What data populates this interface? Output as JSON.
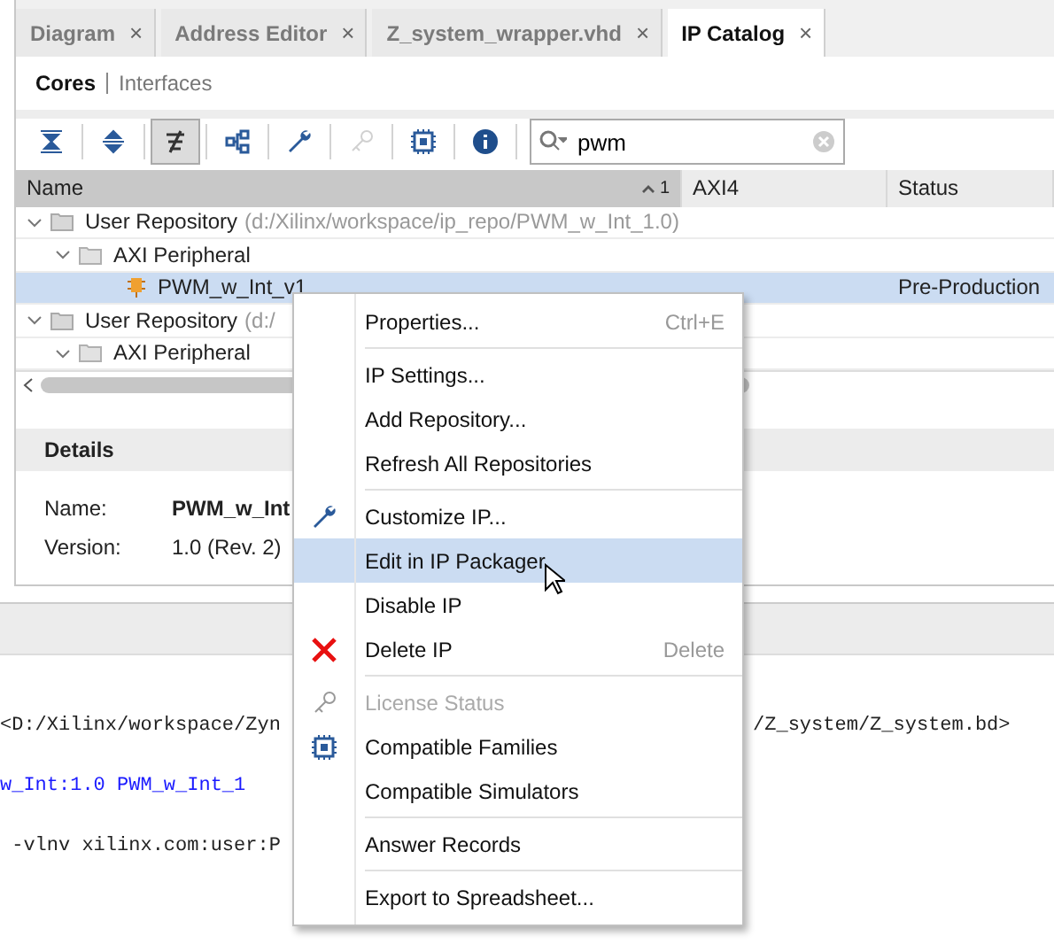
{
  "tabs": [
    {
      "label": "Diagram",
      "close": "×",
      "selected": false
    },
    {
      "label": "Address Editor",
      "close": "×",
      "selected": false
    },
    {
      "label": "Z_system_wrapper.vhd",
      "close": "×",
      "selected": false
    },
    {
      "label": "IP Catalog",
      "close": "×",
      "selected": true
    }
  ],
  "subtabs": [
    {
      "label": "Cores",
      "selected": true
    },
    {
      "label": "Interfaces",
      "selected": false
    }
  ],
  "toolbar": [
    {
      "kind": "collapse",
      "pressed": false,
      "disabled": false
    },
    {
      "kind": "expand",
      "pressed": false,
      "disabled": false
    },
    {
      "kind": "filter",
      "pressed": true,
      "disabled": false
    },
    {
      "kind": "hierarchy",
      "pressed": false,
      "disabled": false
    },
    {
      "kind": "wrench",
      "pressed": false,
      "disabled": false
    },
    {
      "kind": "key",
      "pressed": false,
      "disabled": true
    },
    {
      "kind": "chip",
      "pressed": false,
      "disabled": false
    },
    {
      "kind": "info",
      "pressed": false,
      "disabled": false
    }
  ],
  "search": {
    "value": "pwm"
  },
  "table": {
    "columns": [
      {
        "label": "Name",
        "sorted": true,
        "sort_index": "1"
      },
      {
        "label": "AXI4",
        "sorted": false
      },
      {
        "label": "Status",
        "sorted": false
      }
    ],
    "rows": [
      {
        "kind": "repository",
        "name": "User Repository",
        "path": "(d:/Xilinx/workspace/ip_repo/PWM_w_Int_1.0)",
        "selected": false,
        "expanded": true,
        "children": [
          {
            "kind": "category",
            "name": "AXI Peripheral",
            "selected": false,
            "expanded": true,
            "children": [
              {
                "kind": "ip",
                "name": "PWM_w_Int_v1",
                "status": "Pre-Production",
                "selected": true
              }
            ]
          }
        ]
      },
      {
        "kind": "repository",
        "name": "User Repository",
        "path": "(d:/",
        "selected": false,
        "expanded": true,
        "children": [
          {
            "kind": "category",
            "name": "AXI Peripheral",
            "selected": false,
            "expanded": true
          }
        ]
      }
    ]
  },
  "details": {
    "title": "Details",
    "fields": [
      {
        "label": "Name:",
        "value": "PWM_w_Int",
        "bold": true
      },
      {
        "label": "Version:",
        "value": "1.0 (Rev. 2)",
        "bold": false
      }
    ]
  },
  "console": [
    {
      "left": "<D:/Xilinx/workspace/Zyn",
      "right": "/Z_system/Z_system.bd>",
      "kind": "plain"
    },
    {
      "left": "w_Int:1.0 PWM_w_Int_1",
      "kind": "command"
    },
    {
      "left": " -vlnv xilinx.com:user:P",
      "kind": "plain"
    }
  ],
  "context_menu": [
    {
      "kind": "item",
      "label": "Properties...",
      "shortcut": "Ctrl+E",
      "selected": false,
      "disabled": false
    },
    {
      "kind": "separator"
    },
    {
      "kind": "item",
      "label": "IP Settings...",
      "selected": false,
      "disabled": false
    },
    {
      "kind": "item",
      "label": "Add Repository...",
      "selected": false,
      "disabled": false
    },
    {
      "kind": "item",
      "label": "Refresh All Repositories",
      "selected": false,
      "disabled": false
    },
    {
      "kind": "separator"
    },
    {
      "kind": "item",
      "label": "Customize IP...",
      "selected": false,
      "disabled": false
    },
    {
      "kind": "item",
      "label": "Edit in IP Packager",
      "selected": true,
      "disabled": false
    },
    {
      "kind": "item",
      "label": "Disable IP",
      "selected": false,
      "disabled": false
    },
    {
      "kind": "item",
      "label": "Delete IP",
      "shortcut": "Delete",
      "selected": false,
      "disabled": false
    },
    {
      "kind": "separator"
    },
    {
      "kind": "item",
      "label": "License Status",
      "selected": false,
      "disabled": true
    },
    {
      "kind": "item",
      "label": "Compatible Families",
      "selected": false,
      "disabled": false
    },
    {
      "kind": "item",
      "label": "Compatible Simulators",
      "selected": false,
      "disabled": false
    },
    {
      "kind": "separator"
    },
    {
      "kind": "item",
      "label": "Answer Records",
      "selected": false,
      "disabled": false
    },
    {
      "kind": "separator"
    },
    {
      "kind": "item",
      "label": "Export to Spreadsheet...",
      "selected": false,
      "disabled": false
    }
  ]
}
